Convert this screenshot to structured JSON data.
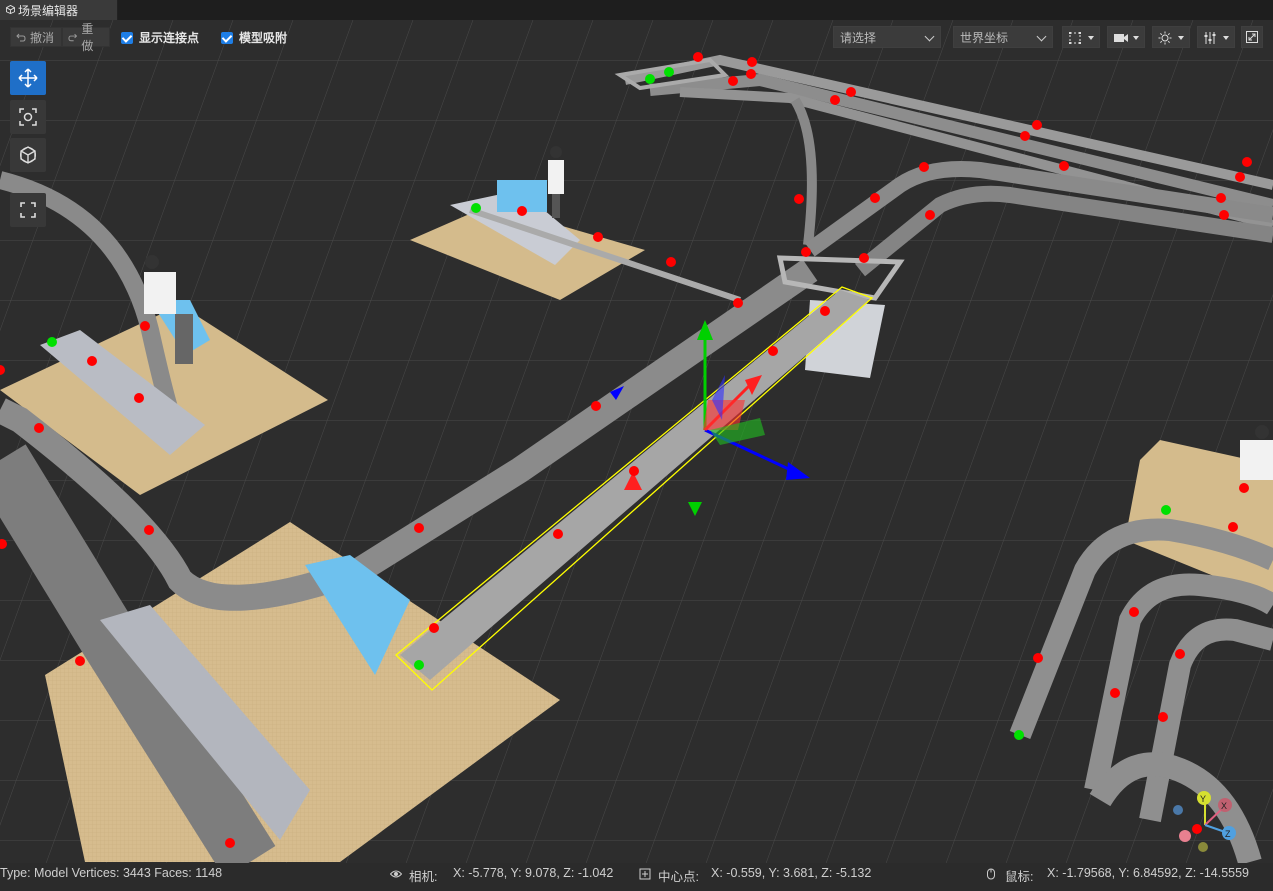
{
  "tab": {
    "title": "场景编辑器"
  },
  "toolbar": {
    "undo_label": "撤消",
    "redo_label": "重做",
    "show_connect_points_label": "显示连接点",
    "show_connect_points_checked": true,
    "model_snap_label": "模型吸附",
    "model_snap_checked": true,
    "select_placeholder": "请选择",
    "coord_select_value": "世界坐标",
    "accent_color": "#1e7ee6"
  },
  "side_tools": [
    {
      "name": "move-tool",
      "icon": "move-arrows-icon",
      "active": true
    },
    {
      "name": "focus-tool",
      "icon": "focus-frame-icon",
      "active": false
    },
    {
      "name": "view-cube-tool",
      "icon": "cube-icon",
      "active": false
    },
    {
      "name": "fullscreen-tool",
      "icon": "fullscreen-icon",
      "active": false
    }
  ],
  "status": {
    "type_info": "Type: Model Vertices: 3443 Faces: 1148",
    "camera_label": "相机:",
    "camera_value": "X: -5.778, Y: 9.078, Z: -1.042",
    "center_label": "中心点:",
    "center_value": "X: -0.559, Y: 3.681, Z: -5.132",
    "mouse_label": "鼠标:",
    "mouse_value": "X: -1.79568, Y: 6.84592, Z: -14.5559"
  },
  "gizmo_axes": [
    "X",
    "Y",
    "Z"
  ],
  "colors": {
    "connect_point_end": "#ff0000",
    "connect_point_start": "#00e000",
    "selection_box": "#ffff00",
    "floor": "#d4bb8c",
    "track": "#8e8e8e"
  }
}
